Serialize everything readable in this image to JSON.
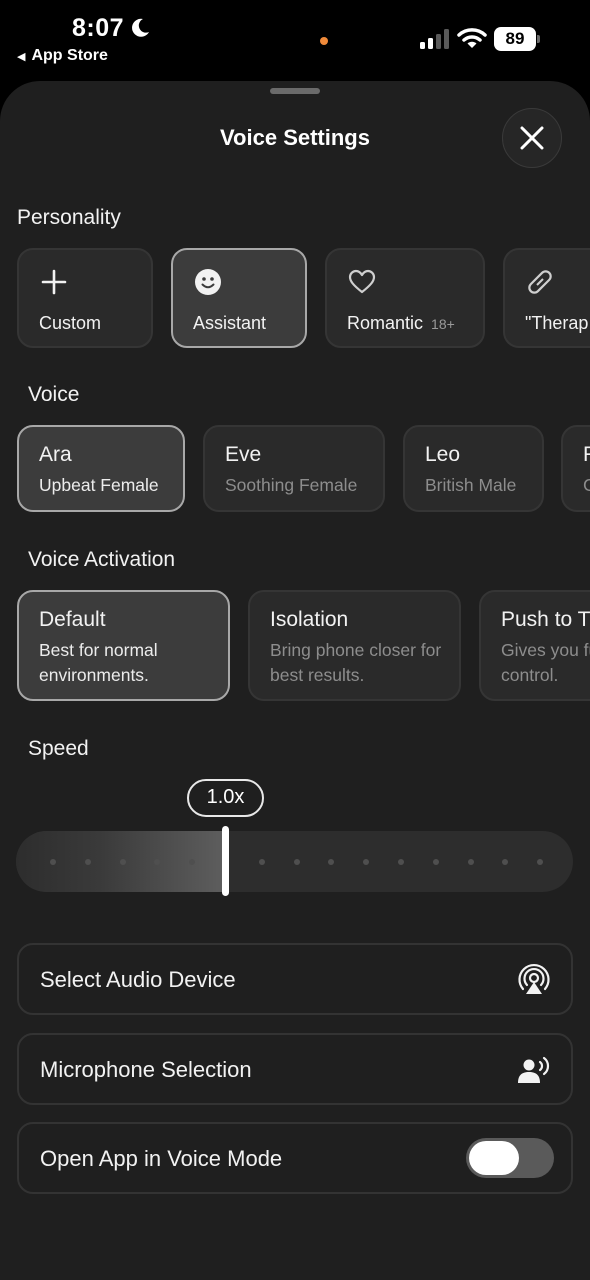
{
  "status_bar": {
    "time": "8:07",
    "back_app": "App Store",
    "battery": "89"
  },
  "sheet": {
    "title": "Voice Settings"
  },
  "personality": {
    "label": "Personality",
    "items": [
      {
        "label": "Custom",
        "icon": "plus-icon",
        "selected": false
      },
      {
        "label": "Assistant",
        "icon": "smiley-icon",
        "selected": true
      },
      {
        "label": "Romantic",
        "badge": "18+",
        "icon": "heart-icon",
        "selected": false
      },
      {
        "label": "\"Therap",
        "icon": "bandage-icon",
        "selected": false
      }
    ]
  },
  "voice": {
    "label": "Voice",
    "items": [
      {
        "name": "Ara",
        "desc": "Upbeat Female",
        "selected": true
      },
      {
        "name": "Eve",
        "desc": "Soothing Female",
        "selected": false
      },
      {
        "name": "Leo",
        "desc": "British Male",
        "selected": false
      },
      {
        "name": "R",
        "desc": "C",
        "selected": false
      }
    ]
  },
  "activation": {
    "label": "Voice Activation",
    "items": [
      {
        "name": "Default",
        "desc": "Best for normal environments.",
        "selected": true
      },
      {
        "name": "Isolation",
        "desc": "Bring phone closer for best results.",
        "selected": false
      },
      {
        "name": "Push to T",
        "desc": "Gives you full control.",
        "selected": false
      }
    ]
  },
  "speed": {
    "label": "Speed",
    "value": "1.0x",
    "fraction": 0.375
  },
  "rows": {
    "audio_device": "Select Audio Device",
    "microphone": "Microphone Selection",
    "voice_mode": "Open App in Voice Mode",
    "voice_mode_on": false
  },
  "colors": {
    "background": "#000000",
    "sheet": "#1f1f1f",
    "card": "#2a2a2a",
    "selected_border": "#a8a8a8",
    "accent_dot": "#f08a3a"
  }
}
